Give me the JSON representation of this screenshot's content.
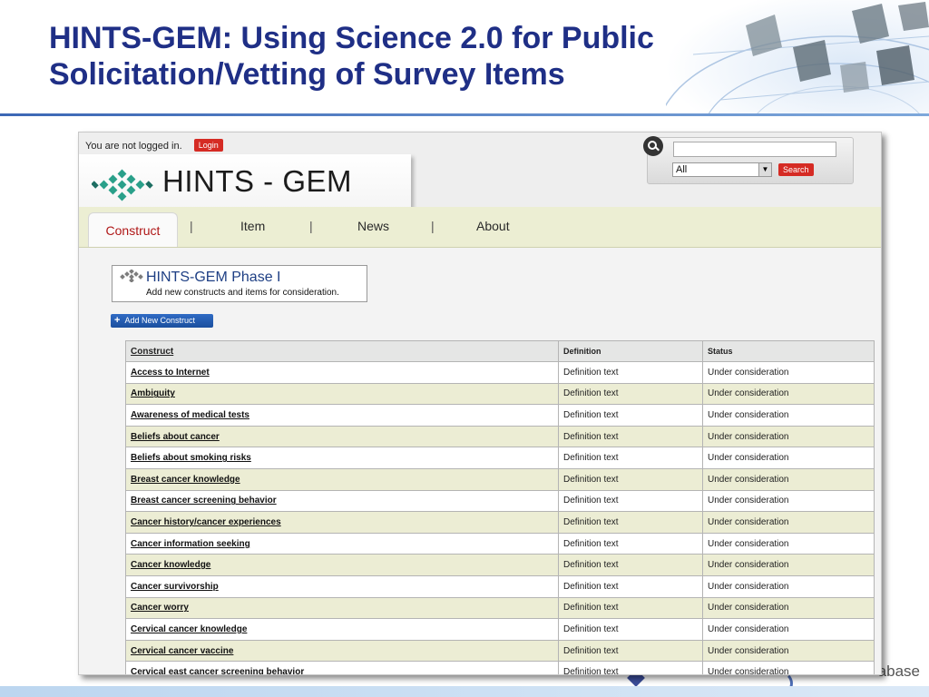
{
  "slide": {
    "title_line1": "HINTS-GEM: Using Science 2.0 for Public",
    "title_line2": "Solicitation/Vetting of Survey Items",
    "footer_fragment": "abase"
  },
  "app": {
    "login_status": "You are not logged in.",
    "login_button": "Login",
    "logo_text": "HINTS - GEM",
    "search": {
      "placeholder": "",
      "scope_value": "All",
      "button": "Search"
    },
    "nav": {
      "tabs": [
        {
          "label": "Construct",
          "active": true
        },
        {
          "label": "Item",
          "active": false
        },
        {
          "label": "News",
          "active": false
        },
        {
          "label": "About",
          "active": false
        }
      ],
      "separator": "|"
    },
    "phase": {
      "title": "HINTS-GEM Phase I",
      "subtitle": "Add new constructs and items for consideration."
    },
    "add_button": "Add New Construct",
    "table": {
      "headers": [
        "Construct",
        "Definition",
        "Status"
      ],
      "rows": [
        {
          "construct": "Access to Internet",
          "definition": "Definition text",
          "status": "Under consideration"
        },
        {
          "construct": "Ambiguity",
          "definition": "Definition text",
          "status": "Under consideration"
        },
        {
          "construct": "Awareness of medical tests",
          "definition": "Definition text",
          "status": "Under consideration"
        },
        {
          "construct": "Beliefs about cancer",
          "definition": "Definition text",
          "status": "Under consideration"
        },
        {
          "construct": "Beliefs about smoking risks",
          "definition": "Definition text",
          "status": "Under consideration"
        },
        {
          "construct": "Breast cancer knowledge",
          "definition": "Definition text",
          "status": "Under consideration"
        },
        {
          "construct": "Breast cancer screening behavior",
          "definition": "Definition text",
          "status": "Under consideration"
        },
        {
          "construct": "Cancer history/cancer experiences",
          "definition": "Definition text",
          "status": "Under consideration"
        },
        {
          "construct": "Cancer information seeking",
          "definition": "Definition text",
          "status": "Under consideration"
        },
        {
          "construct": "Cancer knowledge",
          "definition": "Definition text",
          "status": "Under consideration"
        },
        {
          "construct": "Cancer survivorship",
          "definition": "Definition text",
          "status": "Under consideration"
        },
        {
          "construct": "Cancer worry",
          "definition": "Definition text",
          "status": "Under consideration"
        },
        {
          "construct": "Cervical cancer knowledge",
          "definition": "Definition text",
          "status": "Under consideration"
        },
        {
          "construct": "Cervical cancer vaccine",
          "definition": "Definition text",
          "status": "Under consideration"
        },
        {
          "construct": "Cervical east cancer screening behavior",
          "definition": "Definition text",
          "status": "Under consideration"
        }
      ]
    }
  },
  "colors": {
    "title": "#1f2f86",
    "accent_red": "#d52b24",
    "nav_bg": "#eceed3",
    "row_alt": "#ecedd4",
    "logo_teal": "#2aa08a"
  },
  "icons": [
    "search-icon",
    "hints-gem-logo-icon",
    "dropdown-arrow-icon",
    "plus-icon",
    "phase-logo-icon"
  ]
}
